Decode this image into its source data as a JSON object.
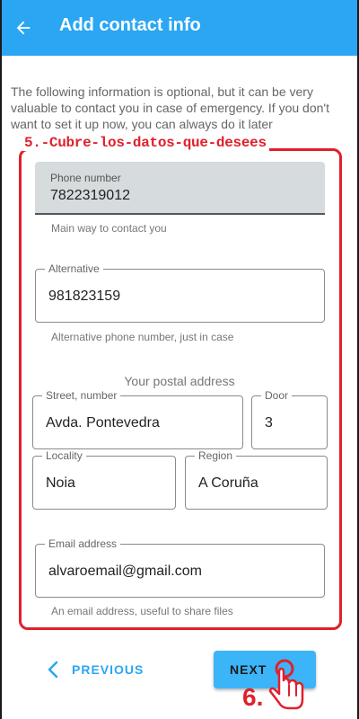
{
  "appbar": {
    "title": "Add contact info",
    "back_icon": "arrow-left-icon",
    "color": "#2aa6f3"
  },
  "intro_text": "The following information is optional, but it can be very valuable to contact you in case of emergency. If you don't want to set it up now, you can always do it later",
  "annotation": {
    "step5": "5.-Cubre-los-datos-que-desees",
    "step6": "6.",
    "color": "#e0202c"
  },
  "fields": {
    "phone": {
      "label": "Phone number",
      "value": "7822319012",
      "helper": "Main way to contact you"
    },
    "alternative": {
      "label": "Alternative",
      "value": "981823159",
      "helper": "Alternative phone number, just in case"
    },
    "postal_heading": "Your postal address",
    "street": {
      "label": "Street, number",
      "value": "Avda. Pontevedra"
    },
    "door": {
      "label": "Door",
      "value": "3"
    },
    "locality": {
      "label": "Locality",
      "value": "Noia"
    },
    "region": {
      "label": "Region",
      "value": "A Coruña"
    },
    "email": {
      "label": "Email address",
      "value": "alvaroemail@gmail.com",
      "helper": "An email address, useful to share files"
    }
  },
  "nav": {
    "previous_label": "PREVIOUS",
    "next_label": "NEXT",
    "previous_icon": "chevron-left-icon",
    "pointer_icon": "hand-pointer-icon"
  }
}
